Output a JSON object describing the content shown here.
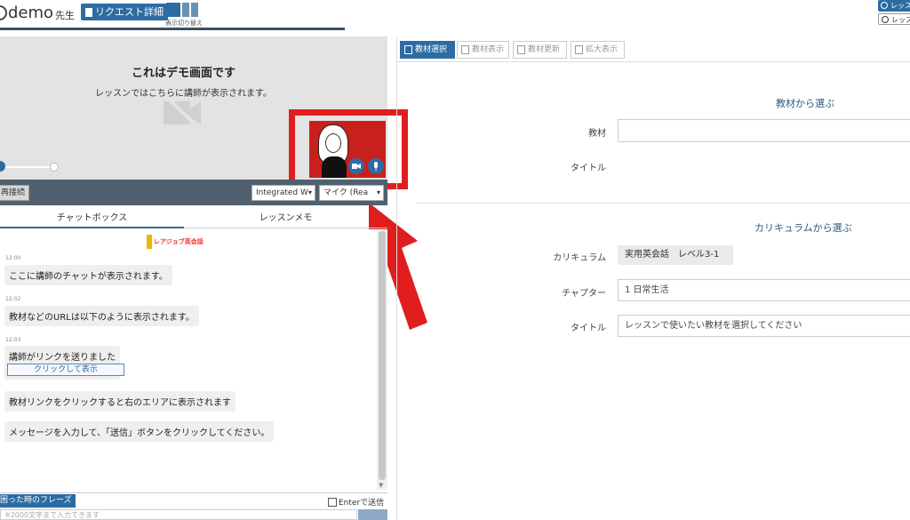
{
  "header": {
    "app_name": "demo",
    "role": "先生",
    "request_detail_label": "リクエスト詳細",
    "layout_toggle_label": "表示切り替え",
    "right_button_1": "レッス",
    "right_button_2": "レッス"
  },
  "video": {
    "title": "これはデモ画面です",
    "subtitle": "レッスンではこちらに講師が表示されます。"
  },
  "device_bar": {
    "reconnect_label": "再接続",
    "camera_select": "Integrated W",
    "mic_select": "マイク (Rea"
  },
  "chat_tabs": {
    "chatbox": "チャットボックス",
    "lesson_memo": "レッスンメモ"
  },
  "chat": {
    "school_logo_text": "レアジョブ英会話",
    "messages": [
      {
        "time": "12:00",
        "text": "ここに講師のチャットが表示されます。"
      },
      {
        "time": "12:02",
        "text": "教材などのURLは以下のように表示されます。"
      },
      {
        "time": "12:03",
        "text": "講師がリンクを送りました"
      },
      {
        "time": "",
        "text": "教材リンクをクリックすると右のエリアに表示されます"
      },
      {
        "time": "",
        "text": "メッセージを入力して、「送信」ボタンをクリックしてください。"
      }
    ],
    "link_button_label": "クリックして表示"
  },
  "composer": {
    "phrases_label": "困った時のフレーズ",
    "enter_send_label": "Enterで送信",
    "placeholder": "※2000文字まで入力できます"
  },
  "right_toolbar": {
    "select_material": "教材選択",
    "show_material": "教材表示",
    "update_material": "教材更新",
    "zoom": "拡大表示"
  },
  "material_section": {
    "title": "教材から選ぶ",
    "material_label": "教材",
    "material_value": "",
    "title_label": "タイトル"
  },
  "curriculum_section": {
    "title": "カリキュラムから選ぶ",
    "curriculum_label": "カリキュラム",
    "curriculum_value": "実用英会話　レベル3-1",
    "chapter_label": "チャプター",
    "chapter_value": "1 日常生活",
    "title_label": "タイトル",
    "title_value": "レッスンで使いたい教材を選択してください"
  },
  "colors": {
    "primary": "#2d6ca3",
    "device_bar": "#50606f",
    "highlight": "#e01e1e"
  }
}
